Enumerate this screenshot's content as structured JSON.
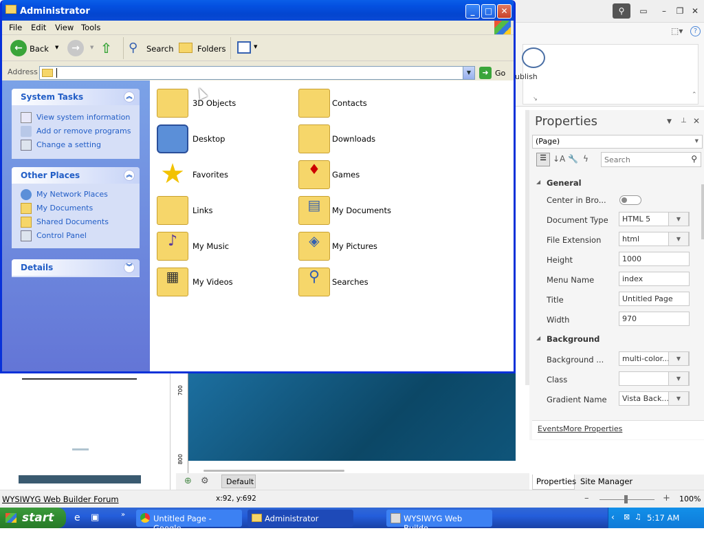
{
  "window": {
    "title": "Administrator",
    "min": "_",
    "max": "□",
    "close": "✕"
  },
  "menu": [
    "File",
    "Edit",
    "View",
    "Tools"
  ],
  "toolbar": {
    "back": "Back",
    "search": "Search",
    "folders": "Folders"
  },
  "address": {
    "label": "Address",
    "value": "",
    "go": "Go"
  },
  "tasks": {
    "system": {
      "title": "System Tasks",
      "items": [
        "View system information",
        "Add or remove programs",
        "Change a setting"
      ]
    },
    "other": {
      "title": "Other Places",
      "items": [
        "My Network Places",
        "My Documents",
        "Shared Documents",
        "Control Panel"
      ]
    },
    "details": {
      "title": "Details"
    }
  },
  "files": {
    "col1": [
      "3D Objects",
      "Desktop",
      "Favorites",
      "Links",
      "My Music",
      "My Videos"
    ],
    "col2": [
      "Contacts",
      "Downloads",
      "Games",
      "My Documents",
      "My Pictures",
      "Searches"
    ]
  },
  "builder": {
    "ribbon_label": "ublish",
    "properties": {
      "title": "Properties",
      "selector": "(Page)",
      "search_placeholder": "Search",
      "general": "General",
      "rows": [
        {
          "label": "Center in Bro...",
          "value": ""
        },
        {
          "label": "Document Type",
          "value": "HTML 5"
        },
        {
          "label": "File Extension",
          "value": "html"
        },
        {
          "label": "Height",
          "value": "1000"
        },
        {
          "label": "Menu Name",
          "value": "index"
        },
        {
          "label": "Title",
          "value": "Untitled Page"
        },
        {
          "label": "Width",
          "value": "970"
        }
      ],
      "background": "Background",
      "bg_rows": [
        {
          "label": "Background ...",
          "value": "multi-color..."
        },
        {
          "label": "Class",
          "value": ""
        },
        {
          "label": "Gradient Name",
          "value": "Vista Back..."
        }
      ],
      "events": "Events",
      "more": "More Properties"
    },
    "tabs": [
      "Properties",
      "Site Manager"
    ],
    "default_tab": "Default",
    "ruler": [
      "700",
      "800"
    ],
    "status_link": "WYSIWYG Web Builder Forum",
    "coords": "x:92, y:692",
    "zoom": "100%"
  },
  "taskbar": {
    "start": "start",
    "tasks": [
      "Untitled Page - Google...",
      "Administrator",
      "WYSIWYG Web Builde..."
    ],
    "clock": "5:17 AM"
  },
  "colors": {
    "xp_blue": "#0450e0",
    "task_link": "#215dc6",
    "taskbar": "#245edb"
  }
}
